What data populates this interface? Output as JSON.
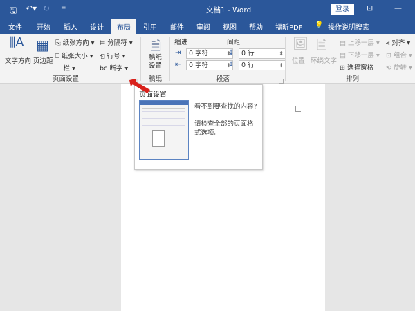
{
  "titlebar": {
    "title": "文档1  -  Word",
    "login": "登录",
    "icons": [
      "save-icon",
      "undo-icon",
      "redo-icon",
      "customize-icon",
      "ribbon-display-icon",
      "minimize-icon"
    ]
  },
  "tabs": [
    "文件",
    "开始",
    "插入",
    "设计",
    "布局",
    "引用",
    "邮件",
    "审阅",
    "视图",
    "帮助",
    "福昕PDF"
  ],
  "active_tab": "布局",
  "search": "操作说明搜索",
  "page_setup": {
    "text_direction": "文字方向",
    "margins": "页边距",
    "orientation": "纸张方向",
    "size": "纸张大小",
    "columns": "栏",
    "breaks": "分隔符",
    "line_numbers": "行号",
    "hyphenation": "断字",
    "group": "页面设置"
  },
  "manuscript": {
    "button": "稿纸设置",
    "group": "稿纸"
  },
  "paragraph": {
    "indent": "缩进",
    "spacing": "间距",
    "indent_left": "0 字符",
    "indent_right": "0 字符",
    "spacing_before": "0 行",
    "spacing_after": "0 行",
    "group": "段落"
  },
  "arrange": {
    "position": "位置",
    "wrap": "环绕文字",
    "forward": "上移一层",
    "backward": "下移一层",
    "selection_pane": "选择窗格",
    "align": "对齐",
    "group_btn": "组合",
    "rotate": "旋转",
    "group": "排列"
  },
  "tooltip": {
    "title": "页面设置",
    "line1": "看不到要查找的内容?",
    "line2": "请检查全部的页面格式选项。"
  },
  "colors": {
    "brand": "#2b579a",
    "ribbon": "#f3f3f3",
    "arrow": "#d9221c"
  }
}
